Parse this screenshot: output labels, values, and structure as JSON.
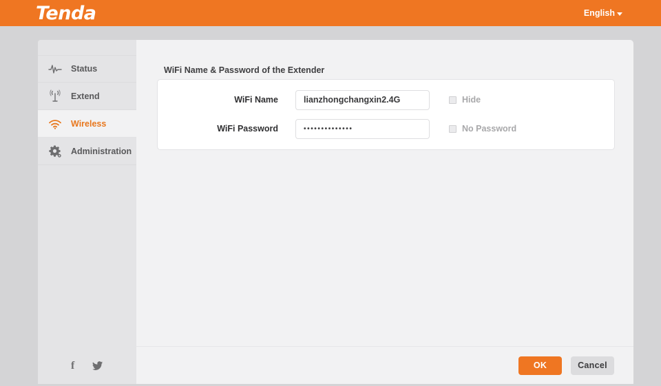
{
  "header": {
    "brand": "Tenda",
    "language": "English",
    "caret_icon": "chevron-down-icon"
  },
  "sidebar": {
    "items": [
      {
        "label": "Status",
        "icon": "pulse-icon",
        "active": false
      },
      {
        "label": "Extend",
        "icon": "antenna-icon",
        "active": false
      },
      {
        "label": "Wireless",
        "icon": "wifi-icon",
        "active": true
      },
      {
        "label": "Administration",
        "icon": "gear-icon",
        "active": false
      }
    ],
    "social": [
      {
        "name": "facebook-icon",
        "glyph": "f"
      },
      {
        "name": "twitter-icon",
        "glyph": ""
      }
    ]
  },
  "main": {
    "panel_title": "WiFi Name & Password of the Extender",
    "fields": [
      {
        "label": "WiFi Name",
        "value": "lianzhongchangxin2.4G",
        "checkbox_label": "Hide",
        "checked": false
      },
      {
        "label": "WiFi Password",
        "value": "••••••••••••••",
        "checkbox_label": "No Password",
        "checked": false
      }
    ]
  },
  "footer": {
    "ok_label": "OK",
    "cancel_label": "Cancel"
  },
  "colors": {
    "brand_orange": "#ef7622",
    "active_orange": "#e8771d",
    "page_background": "#d4d4d6",
    "panel_background": "#f2f2f3",
    "sidebar_background": "#e4e4e6"
  }
}
